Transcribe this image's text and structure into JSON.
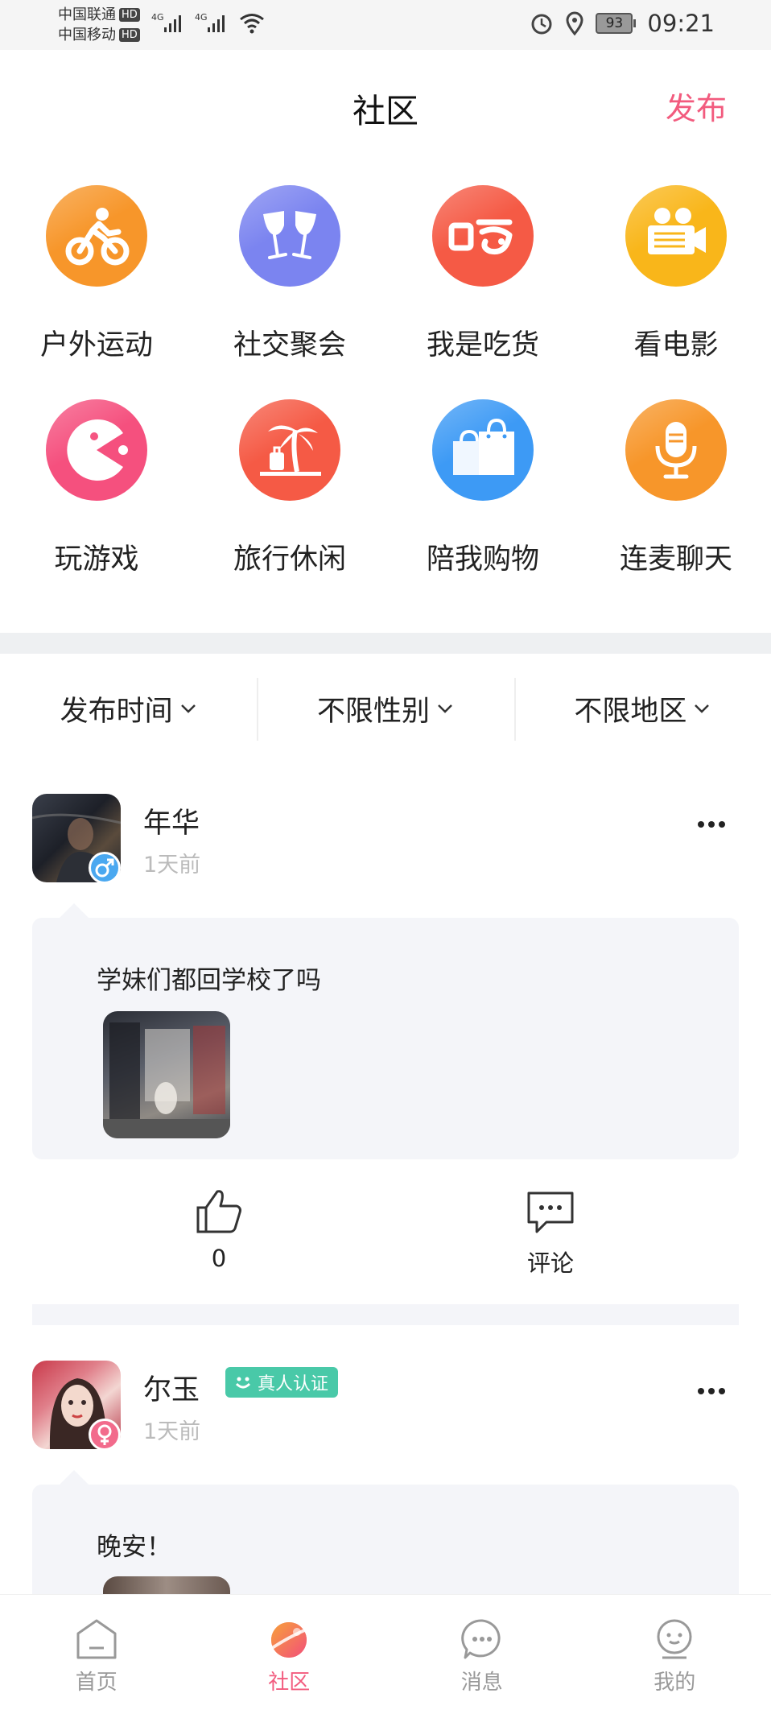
{
  "status_bar": {
    "carrier1": "中国联通",
    "carrier2": "中国移动",
    "hd": "HD",
    "net": "4G",
    "battery": "93",
    "time": "09:21"
  },
  "header": {
    "title": "社区",
    "publish": "发布"
  },
  "categories": [
    {
      "label": "户外运动",
      "icon": "cycling-icon",
      "color": "#f7962a"
    },
    {
      "label": "社交聚会",
      "icon": "wine-glasses-icon",
      "color": "#7b84f0"
    },
    {
      "label": "我是吃货",
      "icon": "food-icon",
      "color": "#f55a45"
    },
    {
      "label": "看电影",
      "icon": "movie-camera-icon",
      "color": "#f9b61a"
    },
    {
      "label": "玩游戏",
      "icon": "pacman-icon",
      "color": "#f5507e"
    },
    {
      "label": "旅行休闲",
      "icon": "palm-tree-icon",
      "color": "#f55a45"
    },
    {
      "label": "陪我购物",
      "icon": "shopping-bags-icon",
      "color": "#3d9af5"
    },
    {
      "label": "连麦聊天",
      "icon": "microphone-icon",
      "color": "#f7962a"
    }
  ],
  "filters": [
    {
      "label": "发布时间"
    },
    {
      "label": "不限性别"
    },
    {
      "label": "不限地区"
    }
  ],
  "posts": [
    {
      "name": "年华",
      "time": "1天前",
      "gender": "male",
      "text": "学妹们都回学校了吗",
      "likes": "0",
      "comment_label": "评论"
    },
    {
      "name": "尔玉",
      "time": "1天前",
      "gender": "female",
      "badge": "真人认证",
      "text": "晚安！"
    }
  ],
  "nav": [
    {
      "label": "首页",
      "icon": "home-icon"
    },
    {
      "label": "社区",
      "icon": "planet-icon",
      "active": true
    },
    {
      "label": "消息",
      "icon": "message-icon"
    },
    {
      "label": "我的",
      "icon": "profile-icon"
    }
  ],
  "colors": {
    "accent": "#f25b7e",
    "male": "#4aa8f0",
    "female": "#f26b8c",
    "verified": "#49c9a8"
  }
}
